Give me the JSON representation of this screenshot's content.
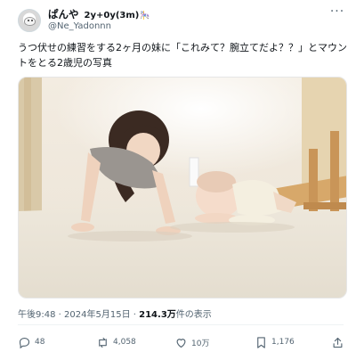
{
  "user": {
    "display_name": "ぱんや",
    "bio_label": "2y+0y(3m)",
    "bio_emoji": "🎠",
    "handle": "@Ne_Yadonnn"
  },
  "tweet": {
    "text": "うつ伏せの練習をする2ヶ月の妹に「これみて？腕立てだよ？？」とマウントをとる2歳児の写真"
  },
  "meta": {
    "time": "午後9:48",
    "separator": "·",
    "date": "2024年5月15日",
    "views_count": "214.3万",
    "views_label": "件の表示"
  },
  "actions": {
    "reply_count": "48",
    "retweet_count": "4,058",
    "like_count": "10万",
    "bookmark_count": "1,176"
  },
  "icons": {
    "more": "more-dots-icon",
    "reply": "reply-icon",
    "retweet": "retweet-icon",
    "like": "heart-icon",
    "bookmark": "bookmark-icon",
    "share": "share-icon"
  },
  "colors": {
    "text": "#0f1419",
    "secondary": "#536471",
    "accent": "#1d9bf0"
  }
}
